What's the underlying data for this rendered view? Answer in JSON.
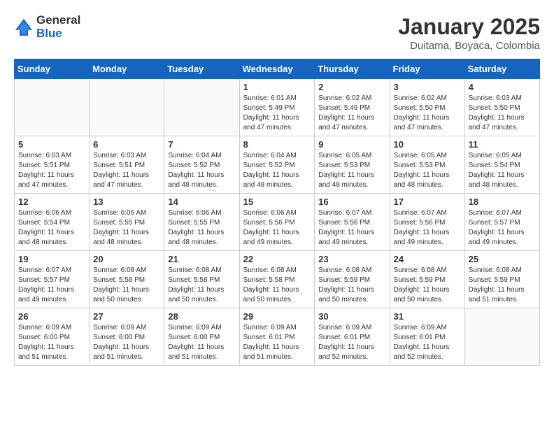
{
  "header": {
    "logo_line1": "General",
    "logo_line2": "Blue",
    "month_year": "January 2025",
    "location": "Duitama, Boyaca, Colombia"
  },
  "weekdays": [
    "Sunday",
    "Monday",
    "Tuesday",
    "Wednesday",
    "Thursday",
    "Friday",
    "Saturday"
  ],
  "weeks": [
    [
      {
        "day": "",
        "info": ""
      },
      {
        "day": "",
        "info": ""
      },
      {
        "day": "",
        "info": ""
      },
      {
        "day": "1",
        "info": "Sunrise: 6:01 AM\nSunset: 5:49 PM\nDaylight: 11 hours\nand 47 minutes."
      },
      {
        "day": "2",
        "info": "Sunrise: 6:02 AM\nSunset: 5:49 PM\nDaylight: 11 hours\nand 47 minutes."
      },
      {
        "day": "3",
        "info": "Sunrise: 6:02 AM\nSunset: 5:50 PM\nDaylight: 11 hours\nand 47 minutes."
      },
      {
        "day": "4",
        "info": "Sunrise: 6:03 AM\nSunset: 5:50 PM\nDaylight: 11 hours\nand 47 minutes."
      }
    ],
    [
      {
        "day": "5",
        "info": "Sunrise: 6:03 AM\nSunset: 5:51 PM\nDaylight: 11 hours\nand 47 minutes."
      },
      {
        "day": "6",
        "info": "Sunrise: 6:03 AM\nSunset: 5:51 PM\nDaylight: 11 hours\nand 47 minutes."
      },
      {
        "day": "7",
        "info": "Sunrise: 6:04 AM\nSunset: 5:52 PM\nDaylight: 11 hours\nand 48 minutes."
      },
      {
        "day": "8",
        "info": "Sunrise: 6:04 AM\nSunset: 5:52 PM\nDaylight: 11 hours\nand 48 minutes."
      },
      {
        "day": "9",
        "info": "Sunrise: 6:05 AM\nSunset: 5:53 PM\nDaylight: 11 hours\nand 48 minutes."
      },
      {
        "day": "10",
        "info": "Sunrise: 6:05 AM\nSunset: 5:53 PM\nDaylight: 11 hours\nand 48 minutes."
      },
      {
        "day": "11",
        "info": "Sunrise: 6:05 AM\nSunset: 5:54 PM\nDaylight: 11 hours\nand 48 minutes."
      }
    ],
    [
      {
        "day": "12",
        "info": "Sunrise: 6:06 AM\nSunset: 5:54 PM\nDaylight: 11 hours\nand 48 minutes."
      },
      {
        "day": "13",
        "info": "Sunrise: 6:06 AM\nSunset: 5:55 PM\nDaylight: 11 hours\nand 48 minutes."
      },
      {
        "day": "14",
        "info": "Sunrise: 6:06 AM\nSunset: 5:55 PM\nDaylight: 11 hours\nand 48 minutes."
      },
      {
        "day": "15",
        "info": "Sunrise: 6:06 AM\nSunset: 5:56 PM\nDaylight: 11 hours\nand 49 minutes."
      },
      {
        "day": "16",
        "info": "Sunrise: 6:07 AM\nSunset: 5:56 PM\nDaylight: 11 hours\nand 49 minutes."
      },
      {
        "day": "17",
        "info": "Sunrise: 6:07 AM\nSunset: 5:56 PM\nDaylight: 11 hours\nand 49 minutes."
      },
      {
        "day": "18",
        "info": "Sunrise: 6:07 AM\nSunset: 5:57 PM\nDaylight: 11 hours\nand 49 minutes."
      }
    ],
    [
      {
        "day": "19",
        "info": "Sunrise: 6:07 AM\nSunset: 5:57 PM\nDaylight: 11 hours\nand 49 minutes."
      },
      {
        "day": "20",
        "info": "Sunrise: 6:08 AM\nSunset: 5:58 PM\nDaylight: 11 hours\nand 50 minutes."
      },
      {
        "day": "21",
        "info": "Sunrise: 6:08 AM\nSunset: 5:58 PM\nDaylight: 11 hours\nand 50 minutes."
      },
      {
        "day": "22",
        "info": "Sunrise: 6:08 AM\nSunset: 5:58 PM\nDaylight: 11 hours\nand 50 minutes."
      },
      {
        "day": "23",
        "info": "Sunrise: 6:08 AM\nSunset: 5:59 PM\nDaylight: 11 hours\nand 50 minutes."
      },
      {
        "day": "24",
        "info": "Sunrise: 6:08 AM\nSunset: 5:59 PM\nDaylight: 11 hours\nand 50 minutes."
      },
      {
        "day": "25",
        "info": "Sunrise: 6:08 AM\nSunset: 5:59 PM\nDaylight: 11 hours\nand 51 minutes."
      }
    ],
    [
      {
        "day": "26",
        "info": "Sunrise: 6:09 AM\nSunset: 6:00 PM\nDaylight: 11 hours\nand 51 minutes."
      },
      {
        "day": "27",
        "info": "Sunrise: 6:09 AM\nSunset: 6:00 PM\nDaylight: 11 hours\nand 51 minutes."
      },
      {
        "day": "28",
        "info": "Sunrise: 6:09 AM\nSunset: 6:00 PM\nDaylight: 11 hours\nand 51 minutes."
      },
      {
        "day": "29",
        "info": "Sunrise: 6:09 AM\nSunset: 6:01 PM\nDaylight: 11 hours\nand 51 minutes."
      },
      {
        "day": "30",
        "info": "Sunrise: 6:09 AM\nSunset: 6:01 PM\nDaylight: 11 hours\nand 52 minutes."
      },
      {
        "day": "31",
        "info": "Sunrise: 6:09 AM\nSunset: 6:01 PM\nDaylight: 11 hours\nand 52 minutes."
      },
      {
        "day": "",
        "info": ""
      }
    ]
  ]
}
